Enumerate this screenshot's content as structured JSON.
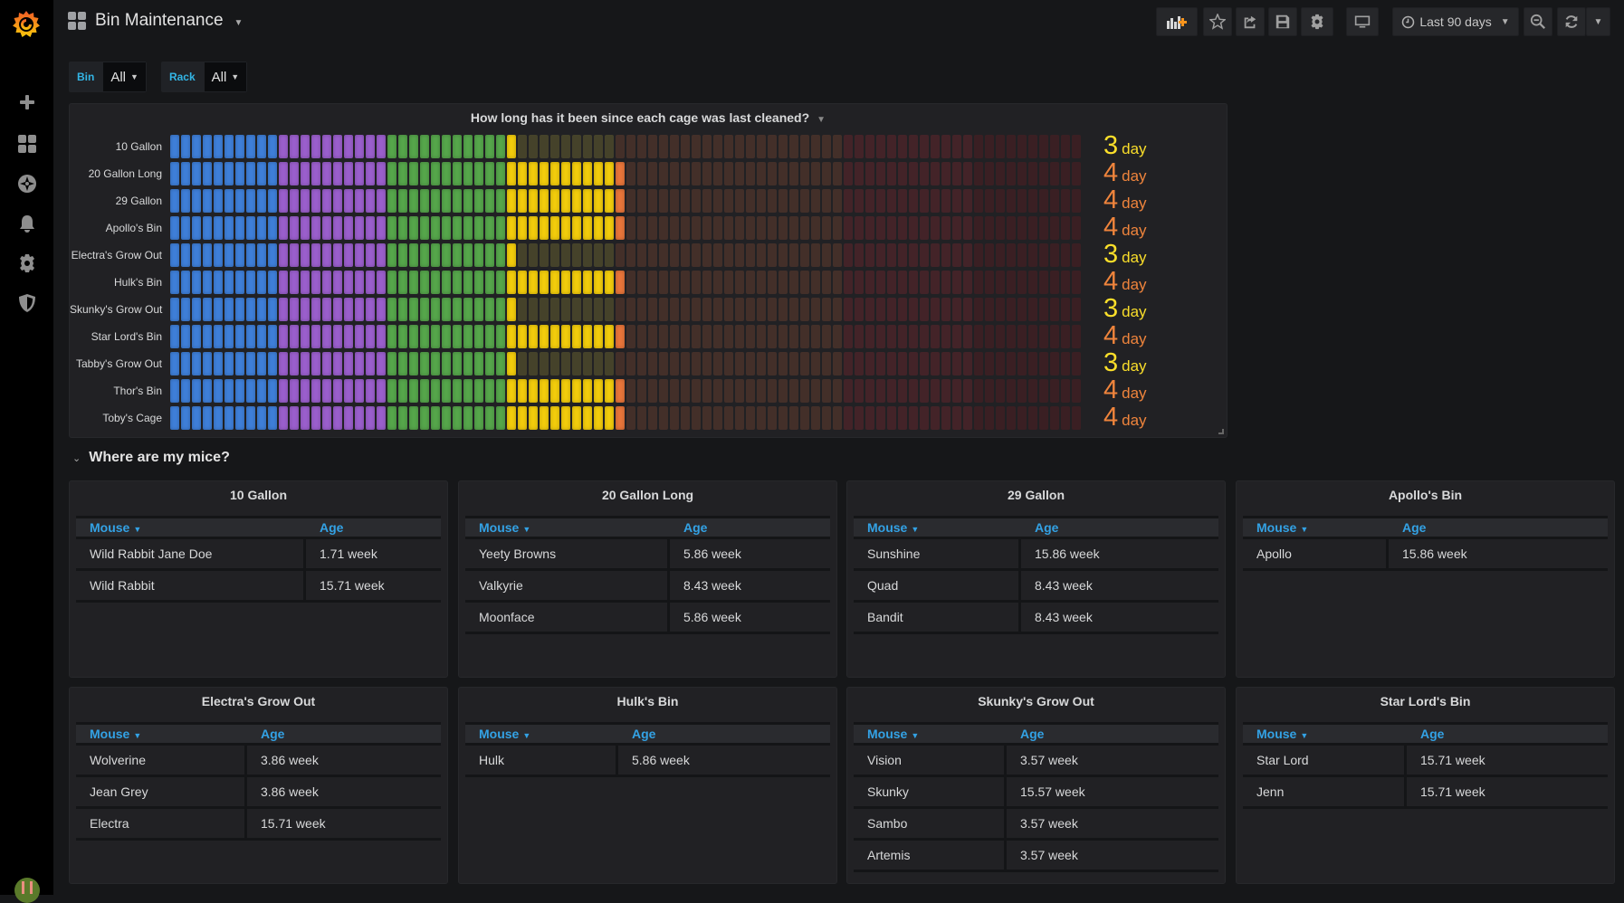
{
  "sidebar": {
    "logo": "grafana-logo",
    "items": [
      {
        "name": "create",
        "icon": "plus-icon"
      },
      {
        "name": "dashboards",
        "icon": "dashboard-grid-icon"
      },
      {
        "name": "explore",
        "icon": "compass-icon"
      },
      {
        "name": "alerting",
        "icon": "bell-icon"
      },
      {
        "name": "configuration",
        "icon": "gear-icon"
      },
      {
        "name": "server-admin",
        "icon": "shield-icon"
      }
    ],
    "user_avatar": "avatar"
  },
  "header": {
    "title": "Bin Maintenance",
    "time_range": "Last 90 days",
    "buttons": [
      "add-panel",
      "star",
      "share",
      "save",
      "settings",
      "tv-mode",
      "time-picker",
      "zoom-out",
      "refresh",
      "refresh-interval"
    ]
  },
  "variables": [
    {
      "label": "Bin",
      "value": "All"
    },
    {
      "label": "Rack",
      "value": "All"
    }
  ],
  "heatmap_panel": {
    "title": "How long has it been since each cage was last cleaned?",
    "unit": "day",
    "colors": {
      "blue": "#3f7fd9",
      "purple": "#9b5fcd",
      "green": "#56a64b",
      "yellow": "#f2cc0c",
      "orange": "#e8753a",
      "yellow_dim": "#45422a",
      "orange_dim": "#432f29",
      "pink_dim": "#432328",
      "red_dim": "#3a1f23"
    },
    "rows": [
      {
        "label": "10 Gallon",
        "value": "3",
        "level": 3
      },
      {
        "label": "20 Gallon Long",
        "value": "4",
        "level": 4
      },
      {
        "label": "29 Gallon",
        "value": "4",
        "level": 4
      },
      {
        "label": "Apollo's Bin",
        "value": "4",
        "level": 4
      },
      {
        "label": "Electra's Grow Out",
        "value": "3",
        "level": 3
      },
      {
        "label": "Hulk's Bin",
        "value": "4",
        "level": 4
      },
      {
        "label": "Skunky's Grow Out",
        "value": "3",
        "level": 3
      },
      {
        "label": "Star Lord's Bin",
        "value": "4",
        "level": 4
      },
      {
        "label": "Tabby's Grow Out",
        "value": "3",
        "level": 3
      },
      {
        "label": "Thor's Bin",
        "value": "4",
        "level": 4
      },
      {
        "label": "Toby's Cage",
        "value": "4",
        "level": 4
      }
    ],
    "value_colors": {
      "3": "#fade2a",
      "4": "#ef843c"
    }
  },
  "row_section": {
    "title": "Where are my mice?"
  },
  "tables": [
    {
      "title": "10 Gallon",
      "col1": "Mouse",
      "col2": "Age",
      "split": 0.63,
      "rows": [
        [
          "Wild Rabbit Jane Doe",
          "1.71 week"
        ],
        [
          "Wild Rabbit",
          "15.71 week"
        ]
      ]
    },
    {
      "title": "20 Gallon Long",
      "col1": "Mouse",
      "col2": "Age",
      "split": 0.56,
      "rows": [
        [
          "Yeety Browns",
          "5.86 week"
        ],
        [
          "Valkyrie",
          "8.43 week"
        ],
        [
          "Moonface",
          "5.86 week"
        ]
      ]
    },
    {
      "title": "29 Gallon",
      "col1": "Mouse",
      "col2": "Age",
      "split": 0.46,
      "rows": [
        [
          "Sunshine",
          "15.86 week"
        ],
        [
          "Quad",
          "8.43 week"
        ],
        [
          "Bandit",
          "8.43 week"
        ]
      ]
    },
    {
      "title": "Apollo's Bin",
      "col1": "Mouse",
      "col2": "Age",
      "split": 0.4,
      "rows": [
        [
          "Apollo",
          "15.86 week"
        ]
      ]
    },
    {
      "title": "Electra's Grow Out",
      "col1": "Mouse",
      "col2": "Age",
      "split": 0.47,
      "rows": [
        [
          "Wolverine",
          "3.86 week"
        ],
        [
          "Jean Grey",
          "3.86 week"
        ],
        [
          "Electra",
          "15.71 week"
        ]
      ]
    },
    {
      "title": "Hulk's Bin",
      "col1": "Mouse",
      "col2": "Age",
      "split": 0.42,
      "rows": [
        [
          "Hulk",
          "5.86 week"
        ]
      ]
    },
    {
      "title": "Skunky's Grow Out",
      "col1": "Mouse",
      "col2": "Age",
      "split": 0.42,
      "rows": [
        [
          "Vision",
          "3.57 week"
        ],
        [
          "Skunky",
          "15.57 week"
        ],
        [
          "Sambo",
          "3.57 week"
        ],
        [
          "Artemis",
          "3.57 week"
        ]
      ]
    },
    {
      "title": "Star Lord's Bin",
      "col1": "Mouse",
      "col2": "Age",
      "split": 0.45,
      "rows": [
        [
          "Star Lord",
          "15.71 week"
        ],
        [
          "Jenn",
          "15.71 week"
        ]
      ]
    }
  ]
}
